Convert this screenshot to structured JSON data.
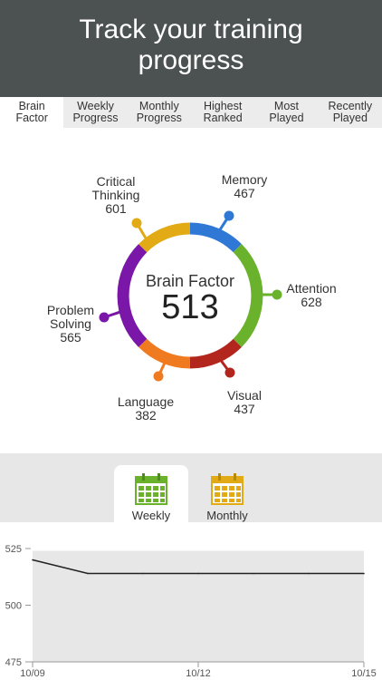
{
  "banner": {
    "line1": "Track your training",
    "line2": "progress"
  },
  "tabs": [
    {
      "line1": "Brain",
      "line2": "Factor"
    },
    {
      "line1": "Weekly",
      "line2": "Progress"
    },
    {
      "line1": "Monthly",
      "line2": "Progress"
    },
    {
      "line1": "Highest",
      "line2": "Ranked"
    },
    {
      "line1": "Most",
      "line2": "Played"
    },
    {
      "line1": "Recently",
      "line2": "Played"
    }
  ],
  "wheel": {
    "center_title": "Brain Factor",
    "center_value": "513",
    "segments": [
      {
        "name1": "Memory",
        "name2": "",
        "value": "467",
        "color": "#2f78d6"
      },
      {
        "name1": "Attention",
        "name2": "",
        "value": "628",
        "color": "#6ab22c"
      },
      {
        "name1": "Visual",
        "name2": "",
        "value": "437",
        "color": "#b3261e"
      },
      {
        "name1": "Language",
        "name2": "",
        "value": "382",
        "color": "#f07a1f"
      },
      {
        "name1": "Problem",
        "name2": "Solving",
        "value": "565",
        "color": "#7a16a8"
      },
      {
        "name1": "Critical",
        "name2": "Thinking",
        "value": "601",
        "color": "#e2ab16"
      }
    ]
  },
  "period_tabs": {
    "weekly": "Weekly",
    "monthly": "Monthly"
  },
  "chart_data": {
    "type": "line",
    "x": [
      "10/09",
      "10/10",
      "10/11",
      "10/12",
      "10/13",
      "10/14",
      "10/15"
    ],
    "y": [
      520,
      514,
      514,
      514,
      514,
      514,
      514
    ],
    "ylim": [
      475,
      525
    ],
    "yticks": [
      "525",
      "500",
      "475"
    ],
    "xtick_labels": [
      "10/09",
      "10/12",
      "10/15"
    ],
    "grid": false
  }
}
